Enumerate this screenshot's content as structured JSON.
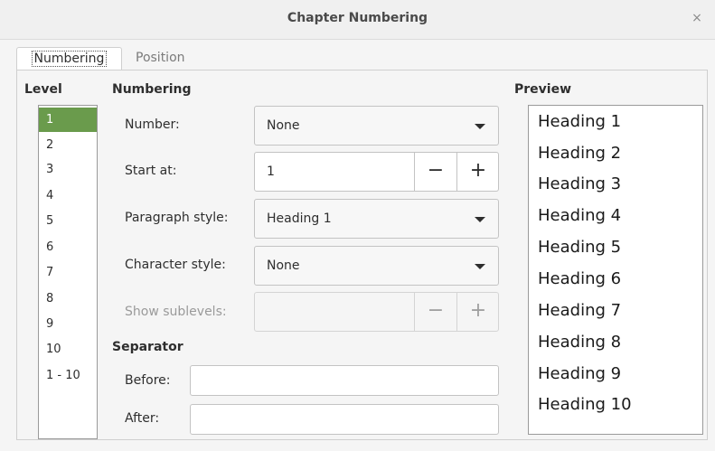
{
  "window": {
    "title": "Chapter Numbering",
    "close_glyph": "×"
  },
  "tabs": [
    {
      "label": "Numbering",
      "active": true
    },
    {
      "label": "Position",
      "active": false
    }
  ],
  "level": {
    "heading": "Level",
    "items": [
      "1",
      "2",
      "3",
      "4",
      "5",
      "6",
      "7",
      "8",
      "9",
      "10",
      "1 - 10"
    ],
    "selected": "1"
  },
  "numbering": {
    "heading": "Numbering",
    "number": {
      "label": "Number:",
      "value": "None"
    },
    "start_at": {
      "label": "Start at:",
      "value": "1"
    },
    "paragraph_style": {
      "label": "Paragraph style:",
      "value": "Heading 1"
    },
    "character_style": {
      "label": "Character style:",
      "value": "None"
    },
    "show_sublevels": {
      "label": "Show sublevels:",
      "value": ""
    },
    "minus_glyph": "−",
    "plus_glyph": "+"
  },
  "separator": {
    "heading": "Separator",
    "before": {
      "label": "Before:",
      "value": ""
    },
    "after": {
      "label": "After:",
      "value": ""
    }
  },
  "preview": {
    "heading": "Preview",
    "lines": [
      "Heading 1",
      "Heading 2",
      "Heading 3",
      "Heading 4",
      "Heading 5",
      "Heading 6",
      "Heading 7",
      "Heading 8",
      "Heading 9",
      "Heading 10"
    ]
  },
  "colors": {
    "selection": "#6a9b4c"
  }
}
